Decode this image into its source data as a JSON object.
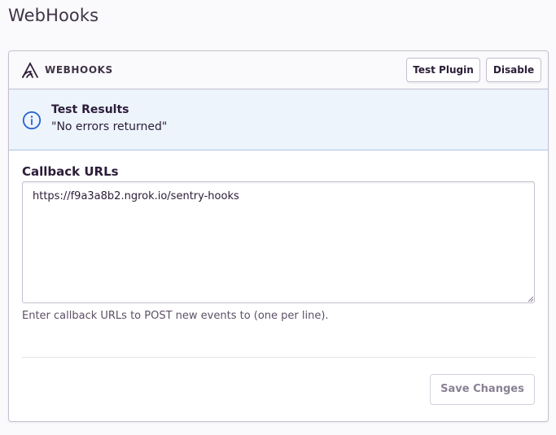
{
  "page": {
    "title": "WebHooks"
  },
  "panel": {
    "header_title": "WEBHOOKS",
    "icon": "webhooks-logo-icon",
    "buttons": {
      "test": "Test Plugin",
      "disable": "Disable"
    }
  },
  "alert": {
    "icon": "info-circle-icon",
    "title": "Test Results",
    "message": "\"No errors returned\"",
    "accent": "#2562d4",
    "background": "#edf4fc"
  },
  "form": {
    "label": "Callback URLs",
    "value": "https://f9a3a8b2.ngrok.io/sentry-hooks",
    "help": "Enter callback URLs to POST new events to (one per line).",
    "save_label": "Save Changes"
  }
}
